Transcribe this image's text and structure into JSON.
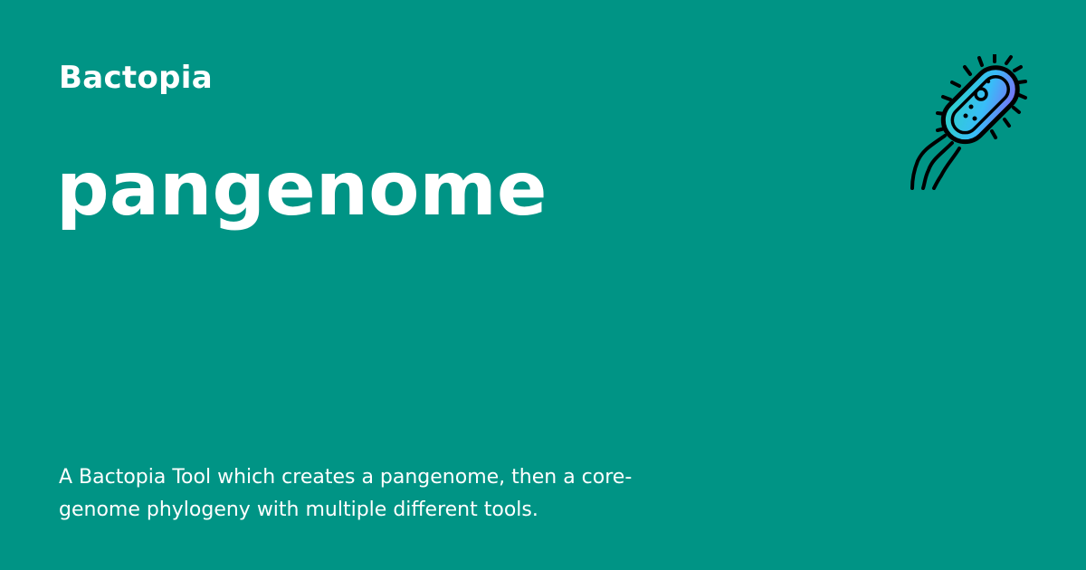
{
  "site": {
    "name": "Bactopia"
  },
  "page": {
    "title": "pangenome",
    "description": "A Bactopia Tool which creates a pangenome, then a core-genome phylogeny with multiple different tools."
  },
  "logo": {
    "icon": "bacterium-icon",
    "gradient_colors": [
      "#8b5cf6",
      "#2dd4bf"
    ],
    "outline_color": "#000000"
  },
  "colors": {
    "background": "#009485",
    "text": "#ffffff"
  }
}
